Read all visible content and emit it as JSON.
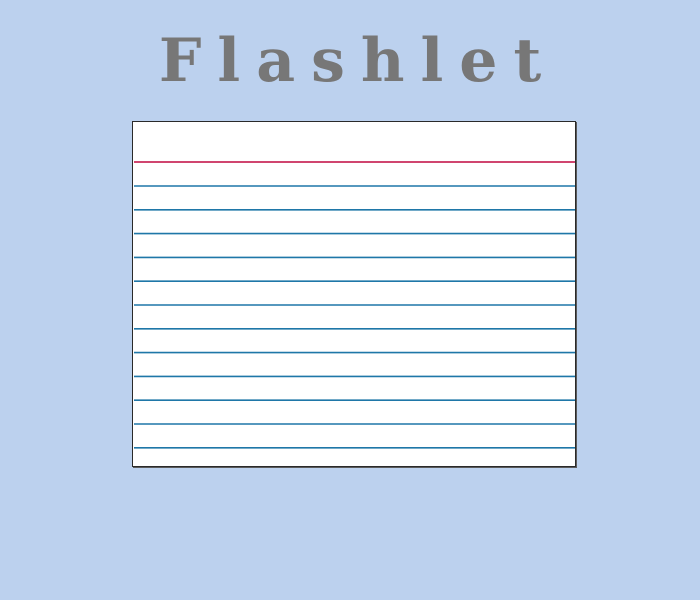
{
  "app": {
    "title": "Flashlet"
  },
  "card": {
    "ruled_line_count": 12,
    "header_line_color": "#d0456f",
    "ruled_line_color": "#1f77a8",
    "background_color": "#ffffff"
  },
  "colors": {
    "page_background": "#bcd1ee",
    "title_text": "#777777"
  }
}
